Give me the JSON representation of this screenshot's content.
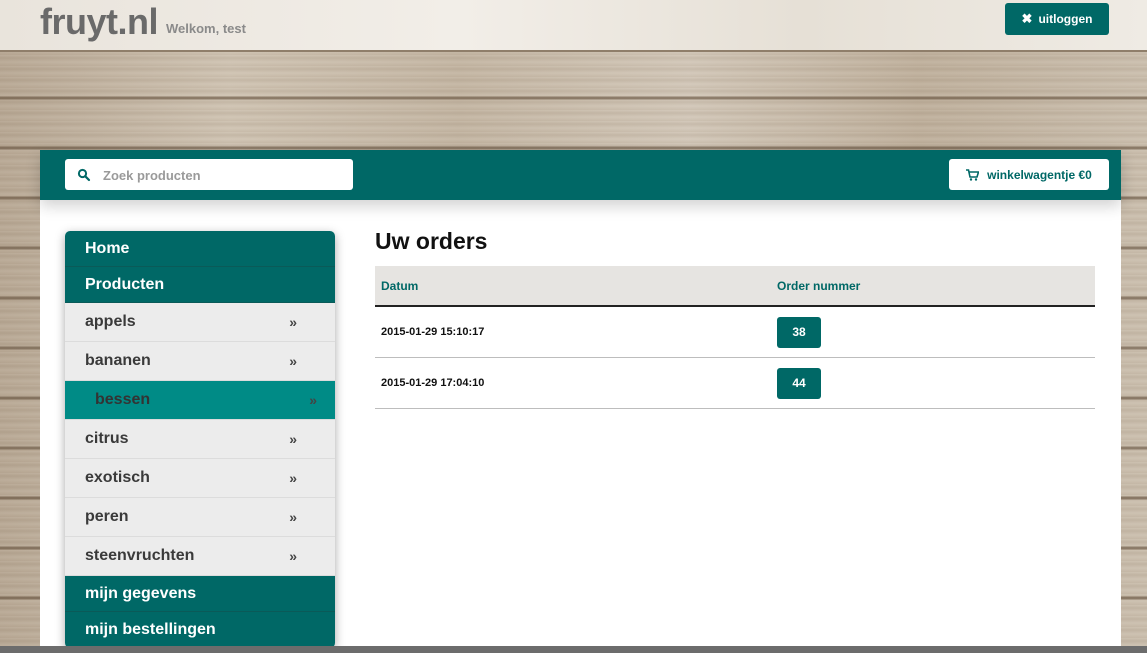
{
  "brand": {
    "logo": "fruyt.nl",
    "welcome": "Welkom, test"
  },
  "header": {
    "logout_label": "uitloggen"
  },
  "toolbar": {
    "search_placeholder": "Zoek producten",
    "cart_label": "winkelwagentje €0"
  },
  "sidebar": {
    "top_items": [
      {
        "label": "Home"
      },
      {
        "label": "Producten"
      }
    ],
    "categories": [
      {
        "label": "appels",
        "active": false
      },
      {
        "label": "bananen",
        "active": false
      },
      {
        "label": "bessen",
        "active": true
      },
      {
        "label": "citrus",
        "active": false
      },
      {
        "label": "exotisch",
        "active": false
      },
      {
        "label": "peren",
        "active": false
      },
      {
        "label": "steenvruchten",
        "active": false
      }
    ],
    "bottom_items": [
      {
        "label": "mijn gegevens"
      },
      {
        "label": "mijn bestellingen"
      }
    ],
    "chevron": "»"
  },
  "orders": {
    "title": "Uw orders",
    "columns": [
      "Datum",
      "Order nummer"
    ],
    "rows": [
      {
        "date": "2015-01-29 15:10:17",
        "number": "38"
      },
      {
        "date": "2015-01-29 17:04:10",
        "number": "44"
      }
    ]
  },
  "colors": {
    "accent": "#006866",
    "active": "#008b86"
  },
  "icons": {
    "logout": "close-icon",
    "search": "search-icon",
    "cart": "cart-icon",
    "category": "double-chevron-right-icon"
  }
}
